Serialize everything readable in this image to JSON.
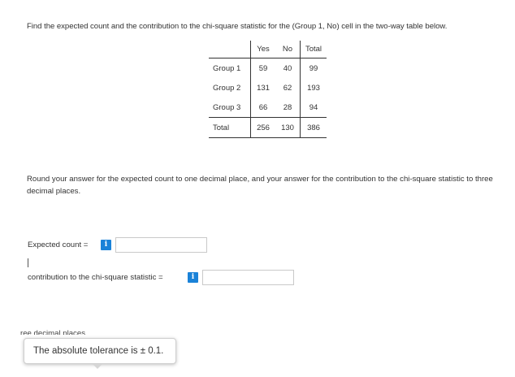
{
  "question": "Find the expected count and the contribution to the chi-square statistic for the (Group 1, No) cell in the two-way table below.",
  "table": {
    "columns": [
      "Yes",
      "No",
      "Total"
    ],
    "rows": [
      {
        "label": "Group 1",
        "values": [
          "59",
          "40",
          "99"
        ]
      },
      {
        "label": "Group 2",
        "values": [
          "131",
          "62",
          "193"
        ]
      },
      {
        "label": "Group 3",
        "values": [
          "66",
          "28",
          "94"
        ]
      },
      {
        "label": "Total",
        "values": [
          "256",
          "130",
          "386"
        ]
      }
    ]
  },
  "instructions": "Round your answer for the expected count to one decimal place, and your answer for the contribution to the chi-square statistic to three decimal places.",
  "expected_count": {
    "label": "Expected count =",
    "info_icon": "i",
    "value": ""
  },
  "contribution": {
    "label": "contribution to the chi-square statistic =",
    "info_icon": "i",
    "value": ""
  },
  "tooltip": {
    "behind_text": "ree decimal places.",
    "text": "The absolute tolerance is ± 0.1."
  },
  "colors": {
    "info_button": "#1a82d8",
    "text": "#333333",
    "input_border": "#c9c9c9"
  }
}
